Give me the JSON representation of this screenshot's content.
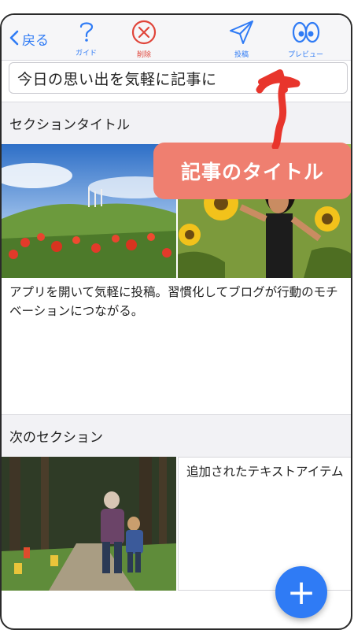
{
  "toolbar": {
    "back_label": "戻る",
    "guide_label": "ガイド",
    "delete_label": "削除",
    "post_label": "投稿",
    "preview_label": "プレビュー"
  },
  "title_input": {
    "value": "今日の思い出を気軽に記事に"
  },
  "annotation": {
    "callout_text": "記事のタイトル"
  },
  "sections": [
    {
      "title": "セクションタイトル",
      "text": "アプリを開いて気軽に投稿。習慣化してブログが行動のモチベーションにつながる。"
    },
    {
      "title": "次のセクション",
      "text": "追加されたテキストアイテム"
    }
  ],
  "fab": {
    "label": "+"
  },
  "colors": {
    "accent": "#2f7bf5",
    "delete": "#e0453a",
    "callout": "#ef7f70",
    "arrow": "#e8352c"
  }
}
